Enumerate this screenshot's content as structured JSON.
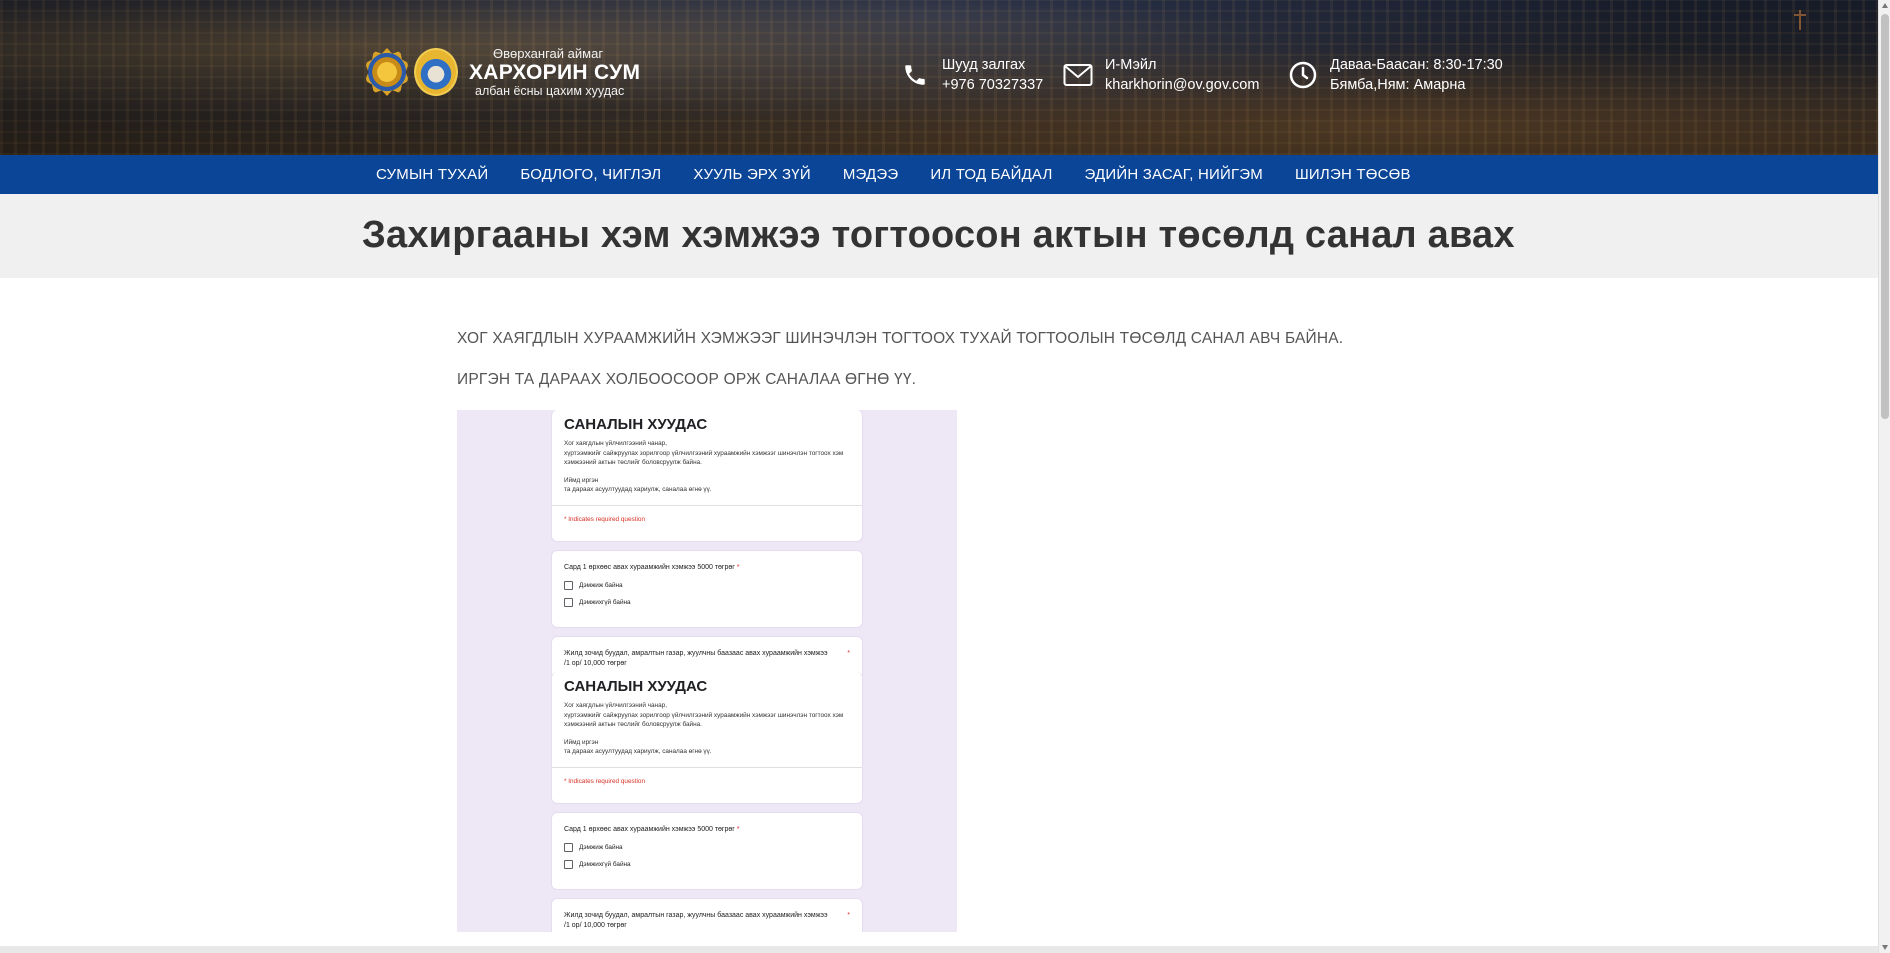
{
  "header": {
    "logo": {
      "line1": "Өвөрхангай аймаг",
      "line2": "ХАРХОРИН СУМ",
      "line3": "албан ёсны цахим хуудас"
    },
    "contacts": [
      {
        "icon": "phone-icon",
        "label": "Шууд залгах",
        "value": "+976 70327337"
      },
      {
        "icon": "mail-icon",
        "label": "И-Мэйл",
        "value": "kharkhorin@ov.gov.com"
      },
      {
        "icon": "clock-icon",
        "label": "Даваа-Баасан: 8:30-17:30",
        "value": "Бямба,Ням: Амарна"
      }
    ]
  },
  "nav": {
    "items": [
      "СУМЫН ТУХАЙ",
      "БОДЛОГО, ЧИГЛЭЛ",
      "ХУУЛЬ ЭРХ ЗҮЙ",
      "МЭДЭЭ",
      "ИЛ ТОД БАЙДАЛ",
      "ЭДИЙН ЗАСАГ, НИЙГЭМ",
      "ШИЛЭН ТӨСӨВ"
    ]
  },
  "page": {
    "title": "Захиргааны хэм хэмжээ тогтоосон актын төсөлд санал авах",
    "paragraph1": "ХОГ ХАЯГДЛЫН ХУРААМЖИЙН ХЭМЖЭЭГ ШИНЭЧЛЭН ТОГТООХ ТУХАЙ ТОГТООЛЫН ТӨСӨЛД САНАЛ АВЧ БАЙНА.",
    "paragraph2": "ИРГЭН ТА ДАРААХ ХОЛБООСООР ОРЖ САНАЛАА ӨГНӨ ҮҮ."
  },
  "form": {
    "title": "САНАЛЫН ХУУДАС",
    "desc1": "Хог хаягдлын үйлчилгээний чанар,",
    "desc2": "хүртээмжийг сайжруулах зорилгоор үйлчилгээний хураамжийн хэмжээг шинэчлэн тогтоох хэм",
    "desc3": "хэмжээний актын төслийг боловсруулж байна.",
    "desc4": "Иймд иргэн",
    "desc5": "та дараах асуултуудад хариулж, саналаа өгнө үү.",
    "required": "* Indicates required question",
    "q1": "Сард 1 өрхөөс авах хураамжийн хэмжээ 5000 төгрөг",
    "q1_star": "*",
    "opt_yes": "Дэмжиж байна",
    "opt_no": "Дэмжихгүй байна",
    "q2": "Жилд зочид буудал, амралтын газар, жуулчны баазаас авах хураамжийн хэмжээ /1 ор/ 10,000 төгрөг",
    "q2_star": "*"
  }
}
